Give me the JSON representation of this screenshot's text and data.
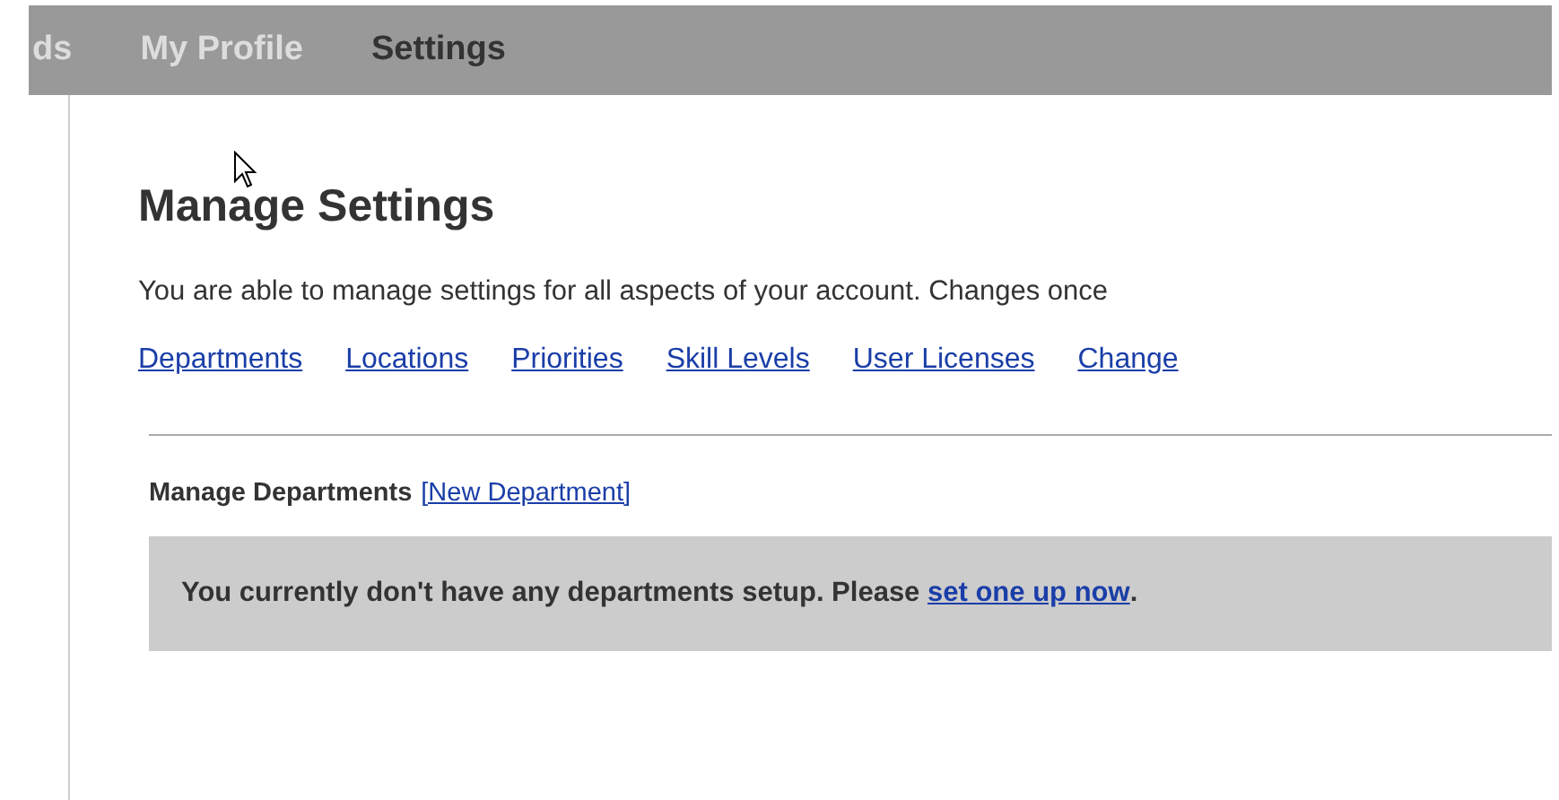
{
  "nav_tabs": [
    {
      "label": "ds",
      "selected": false
    },
    {
      "label": "My Profile",
      "selected": false
    },
    {
      "label": "Settings",
      "selected": true
    }
  ],
  "title": "Manage Settings",
  "intro": "You are able to manage settings for all aspects of your account. Changes once",
  "links": [
    "Departments",
    "Locations",
    "Priorities",
    "Skill Levels",
    "User Licenses",
    "Change"
  ],
  "section": {
    "heading": "Manage Departments",
    "action_link": "[New Department]"
  },
  "notice": {
    "text": "You currently don't have any departments setup. Please",
    "link": "set one up now",
    "end": "."
  }
}
